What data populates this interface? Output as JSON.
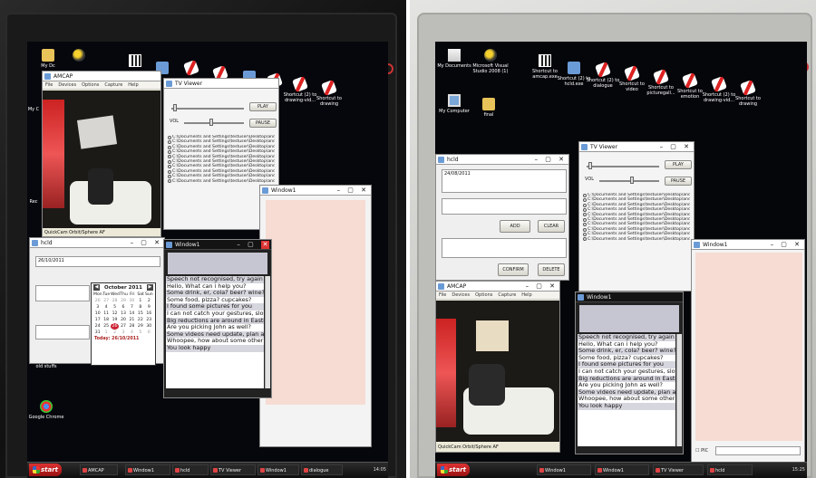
{
  "left": {
    "desktop_icons": [
      {
        "label": "My Dc",
        "icon": "my-documents-icon"
      },
      {
        "label": "",
        "icon": "bees-icon"
      },
      {
        "label": "",
        "icon": "qr-icon"
      },
      {
        "label": "",
        "icon": "app-icon"
      },
      {
        "label": "",
        "icon": "drawing-shortcut-icon"
      },
      {
        "label": "",
        "icon": "drawing-shortcut-icon"
      },
      {
        "label": "",
        "icon": "app-icon"
      },
      {
        "label": "",
        "icon": "drawing-shortcut-icon"
      },
      {
        "label": "Shortcut (2) to drawing-vid...",
        "icon": "drawing-shortcut-icon"
      },
      {
        "label": "Shortcut to drawing",
        "icon": "drawing-shortcut-icon"
      },
      {
        "label": "My C",
        "icon": "my-computer-icon"
      },
      {
        "label": "Rec",
        "icon": "recycle-bin-icon"
      },
      {
        "label": "old stuffs",
        "icon": "folder-icon"
      },
      {
        "label": "Google Chrome",
        "icon": "chrome-icon"
      }
    ],
    "amcap": {
      "title": "AMCAP",
      "menu": [
        "File",
        "Devices",
        "Options",
        "Capture",
        "Help"
      ],
      "status": "QuickCam Orbit/Sphere AF"
    },
    "tv_viewer": {
      "title": "TV Viewer",
      "play": "PLAY",
      "pause": "PAUSE",
      "vol_label": "VOL",
      "vol_level": 0.45,
      "files": [
        "C:\\Documents and Settings\\testuser\\Desktop\\andls\\Vesour",
        "C:\\Documents and Settings\\testuser\\Desktop\\andls\\Vesour",
        "C:\\Documents and Settings\\testuser\\Desktop\\andls\\Vesour",
        "C:\\Documents and Settings\\testuser\\Desktop\\andls\\Vesour",
        "C:\\Documents and Settings\\testuser\\Desktop\\andls\\Vesour",
        "C:\\Documents and Settings\\testuser\\Desktop\\andls\\Vesour",
        "C:\\Documents and Settings\\testuser\\Desktop\\andls\\Vesour",
        "C:\\Documents and Settings\\testuser\\Desktop\\andls\\Vesour",
        "C:\\Documents and Settings\\testuser\\Desktop\\andls\\Vesour",
        "C:\\Documents and Settings\\testuser\\Desktop\\andls\\Vesour"
      ]
    },
    "window1_blank": {
      "title": "Window1"
    },
    "hcld": {
      "title": "hcld",
      "date_value": "26/10/2011",
      "calendar": {
        "month": "October 2011",
        "weekdays": [
          "Mon",
          "Tue",
          "Wed",
          "Thu",
          "Fri",
          "Sat",
          "Sun"
        ],
        "days": [
          "26",
          "27",
          "28",
          "29",
          "30",
          "1",
          "2",
          "3",
          "4",
          "5",
          "6",
          "7",
          "8",
          "9",
          "10",
          "11",
          "12",
          "13",
          "14",
          "15",
          "16",
          "17",
          "18",
          "19",
          "20",
          "21",
          "22",
          "23",
          "24",
          "25",
          "26",
          "27",
          "28",
          "29",
          "30",
          "31",
          "1",
          "2",
          "3",
          "4",
          "5",
          "6"
        ],
        "today_label": "Today: 26/10/2011"
      }
    },
    "window1_chat": {
      "title": "Window1",
      "lines": [
        "Speech not recognised, try again plea",
        "Hello, What can i help you?",
        "Some drink, er, cola? beer? wine?",
        "Some food, pizza? cupcakes?",
        "I found some pictures for you",
        "I can not catch your gestures, slow do",
        "Big reductions are around in Easter",
        "Are you picking John as well?",
        "Some videos need update, plan an up",
        "Whoopee, how about some other phot",
        "You look happy"
      ]
    },
    "taskbar": {
      "start": "start",
      "items": [
        "AMCAP",
        "Window1",
        "hcld",
        "TV Viewer",
        "Window1",
        "dialogue"
      ],
      "clock": "14:05"
    }
  },
  "right": {
    "desktop_icons": [
      {
        "label": "My Documents",
        "icon": "my-documents-icon"
      },
      {
        "label": "Microsoft Visual Studio 2008 (1)",
        "icon": "visual-studio-icon"
      },
      {
        "label": "Shortcut to amcap.exe",
        "icon": "qr-icon"
      },
      {
        "label": "Shortcut (2) to hcld.exe",
        "icon": "app-icon"
      },
      {
        "label": "Shortcut (2) to dialogue",
        "icon": "drawing-shortcut-icon"
      },
      {
        "label": "Shortcut to video",
        "icon": "drawing-shortcut-icon"
      },
      {
        "label": "Shortcut to picturegall...",
        "icon": "drawing-shortcut-icon"
      },
      {
        "label": "Shortcut to emotion",
        "icon": "drawing-shortcut-icon"
      },
      {
        "label": "Shortcut (2) to drawing-vid...",
        "icon": "drawing-shortcut-icon"
      },
      {
        "label": "Shortcut to drawing",
        "icon": "drawing-shortcut-icon"
      },
      {
        "label": "My Computer",
        "icon": "my-computer-icon"
      },
      {
        "label": "final",
        "icon": "folder-icon"
      }
    ],
    "hcld": {
      "title": "hcld",
      "date_value": "24/08/2011",
      "add": "ADD",
      "clear": "CLEAR",
      "confirm": "CONFIRM",
      "delete": "DELETE"
    },
    "tv_viewer": {
      "title": "TV Viewer",
      "play": "PLAY",
      "pause": "PAUSE",
      "vol_label": "VOL",
      "vol_level": 0.55,
      "files": [
        "C:\\Documents and Settings\\testuser\\Desktop\\andls\\Vesour",
        "C:\\Documents and Settings\\testuser\\Desktop\\andls\\Vesour",
        "C:\\Documents and Settings\\testuser\\Desktop\\andls\\Vesour",
        "C:\\Documents and Settings\\testuser\\Desktop\\andls\\Vesour",
        "C:\\Documents and Settings\\testuser\\Desktop\\andls\\Vesour",
        "C:\\Documents and Settings\\testuser\\Desktop\\andls\\Vesour",
        "C:\\Documents and Settings\\testuser\\Desktop\\andls\\Vesour",
        "C:\\Documents and Settings\\testuser\\Desktop\\andls\\Vesour",
        "C:\\Documents and Settings\\testuser\\Desktop\\andls\\Vesour",
        "C:\\Documents and Settings\\testuser\\Desktop\\andls\\Vesour"
      ]
    },
    "window1_blank": {
      "title": "Window1",
      "pic_label": "PIC"
    },
    "amcap": {
      "title": "AMCAP",
      "menu": [
        "File",
        "Devices",
        "Options",
        "Capture",
        "Help"
      ],
      "status": "QuickCam Orbit/Sphere AF"
    },
    "window1_chat": {
      "title": "Window1",
      "lines": [
        "Speech not recognised, try again plea",
        "Hello, What can i help you?",
        "Some drink, er, cola? beer? wine?",
        "Some food, pizza? cupcakes?",
        "I found some pictures for you",
        "I can not catch your gestures, slow do",
        "Big reductions are around in Easter",
        "Are you picking John as well?",
        "Some videos need update, plan an up",
        "Whoopee, how about some other phot",
        "You look happy"
      ]
    },
    "taskbar": {
      "start": "start",
      "items": [
        "Window1",
        "Window1",
        "TV Viewer",
        "hcld"
      ],
      "clock": "15:25"
    }
  }
}
